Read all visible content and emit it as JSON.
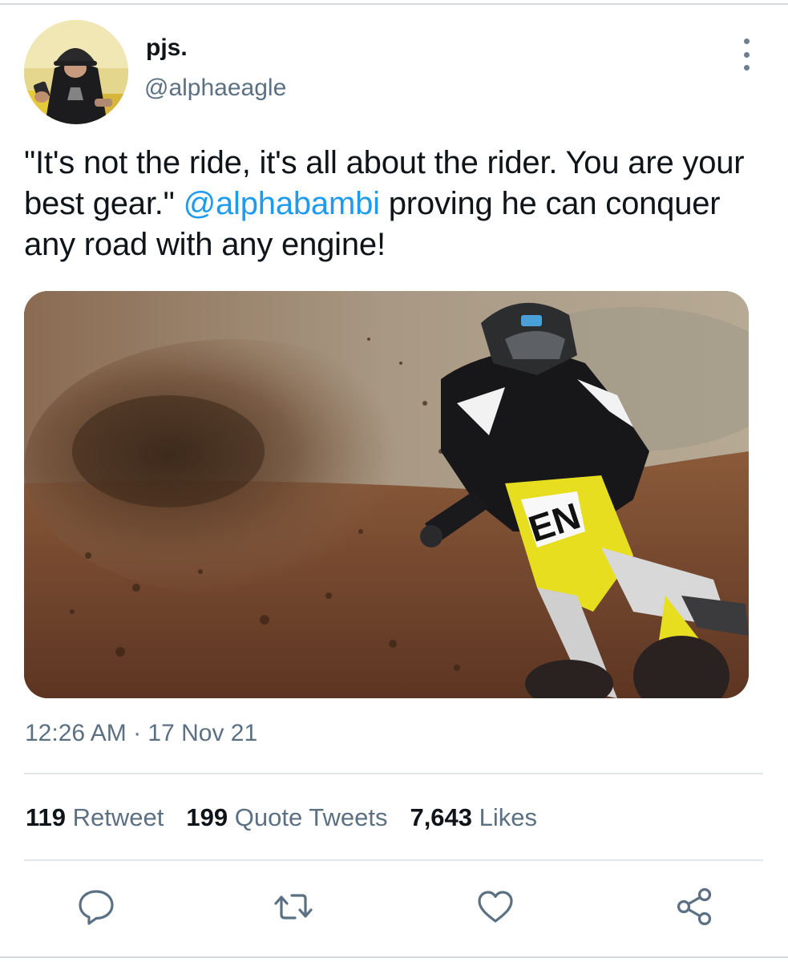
{
  "tweet": {
    "author": {
      "display_name": "pjs.",
      "handle": "@alphaeagle"
    },
    "text": {
      "part1": "\"It's not the ride, it's all about the rider. You are your best gear.\" ",
      "mention": "@alphabambi",
      "part2": " proving he can conquer any road with any engine!"
    },
    "timestamp": "12:26 AM · 17 Nov 21",
    "stats": {
      "retweets": {
        "count": "119",
        "label": "Retweet"
      },
      "quotes": {
        "count": "199",
        "label": "Quote Tweets"
      },
      "likes": {
        "count": "7,643",
        "label": "Likes"
      }
    },
    "actions": [
      "reply-icon",
      "retweet-icon",
      "like-icon",
      "share-icon"
    ],
    "colors": {
      "mention": "#1d9bf0",
      "secondary_text": "#5b7083",
      "primary_text": "#0f1419",
      "bike_yellow": "#e6de1e"
    }
  }
}
